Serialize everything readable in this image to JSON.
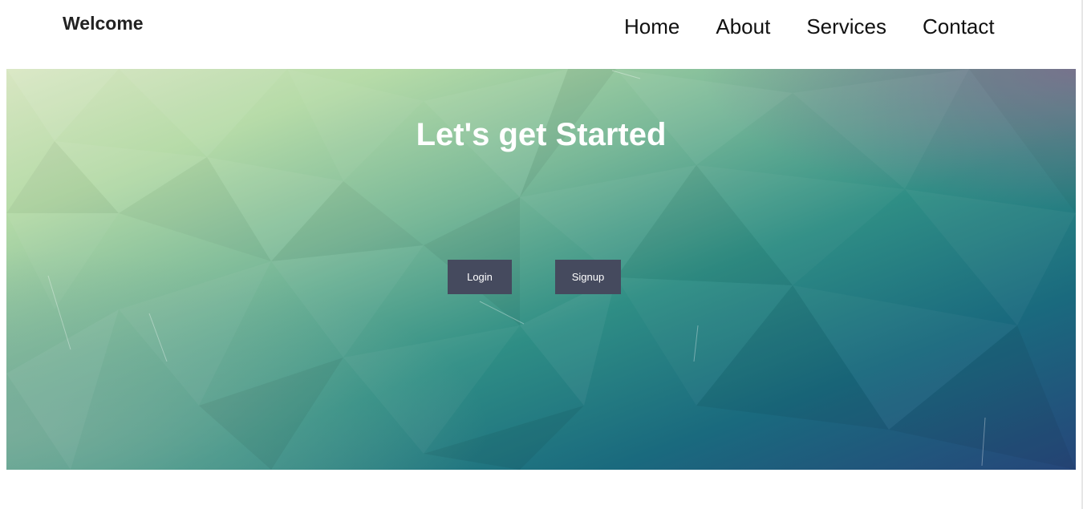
{
  "header": {
    "brand": "Welcome",
    "nav": [
      "Home",
      "About",
      "Services",
      "Contact"
    ]
  },
  "hero": {
    "title": "Let's get Started",
    "login_label": "Login",
    "signup_label": "Signup"
  },
  "colors": {
    "button_bg": "#454a5e",
    "hero_gradient": [
      "#d8e8c4",
      "#b7dcaa",
      "#6fb292",
      "#2a8a80",
      "#1c6b7e",
      "#2a4c7a",
      "#7c7a92"
    ]
  }
}
